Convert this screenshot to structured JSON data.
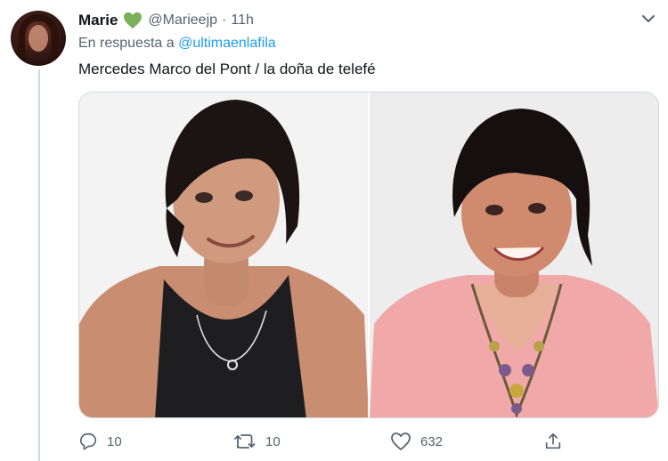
{
  "tweet": {
    "author_name": "Marie",
    "handle": "@Marieejp",
    "separator": "·",
    "time": "11h",
    "reply_prefix": "En respuesta a",
    "reply_to": "@ultimaenlafila",
    "text": "Mercedes Marco del Pont / la doña de telefé",
    "badge_icon": "green-heart-icon",
    "accent_color": "#1d9bf0",
    "badge_color": "#78b159"
  },
  "actions": {
    "reply_count": "10",
    "retweet_count": "10",
    "like_count": "632"
  },
  "icons": [
    "reply-icon",
    "retweet-icon",
    "like-icon",
    "share-icon",
    "chevron-down-icon"
  ]
}
